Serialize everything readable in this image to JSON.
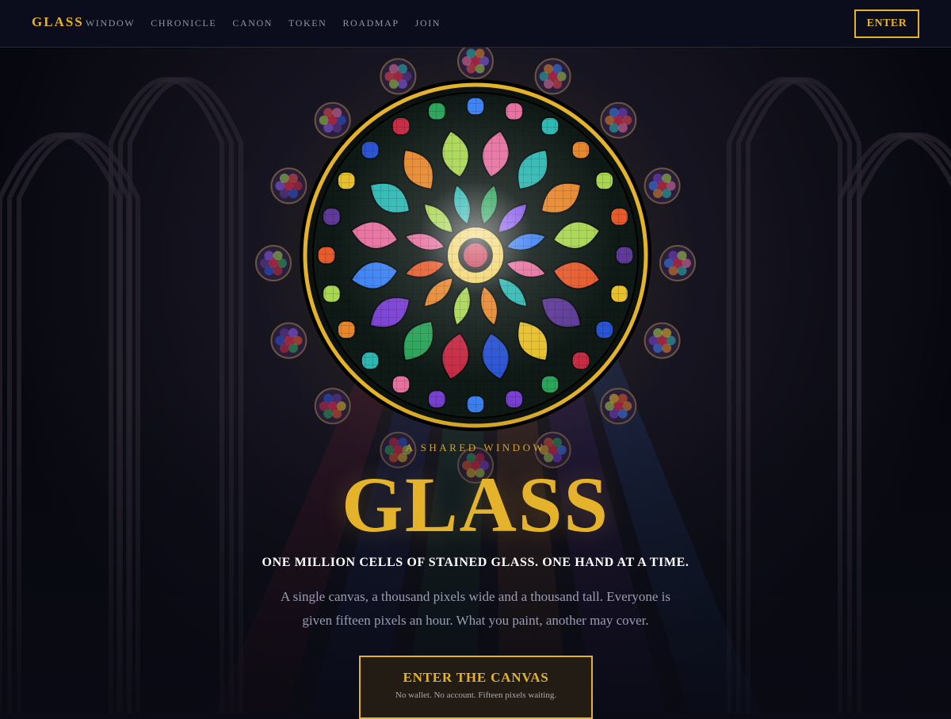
{
  "nav": {
    "brand": "GLASS",
    "links": [
      "WINDOW",
      "CHRONICLE",
      "CANON",
      "TOKEN",
      "ROADMAP",
      "JOIN"
    ],
    "enter_label": "ENTER"
  },
  "hero": {
    "eyebrow": "A SHARED WINDOW",
    "title": "GLASS",
    "tagline": "ONE MILLION CELLS OF STAINED GLASS. ONE HAND AT A TIME.",
    "description": "A single canvas, a thousand pixels wide and a thousand tall. Everyone is given fifteen pixels an hour. What you paint, another may cover.",
    "cta_label": "ENTER THE CANVAS",
    "cta_sub": "No wallet. No account. Fifteen pixels waiting."
  },
  "colors": {
    "accent": "#e5b32b",
    "background": "#0a0b14",
    "glass": [
      "#e86fa0",
      "#2bb8b3",
      "#e8862a",
      "#3b82f6",
      "#7b3fd6",
      "#a8d64f",
      "#e8c02a",
      "#e85a2a",
      "#2aa55a",
      "#c92a44",
      "#2a54d6",
      "#5f3a9a",
      "#8a5cf0",
      "#9ad04a",
      "#e8484a"
    ]
  },
  "icons": [
    "rose-window-icon"
  ]
}
